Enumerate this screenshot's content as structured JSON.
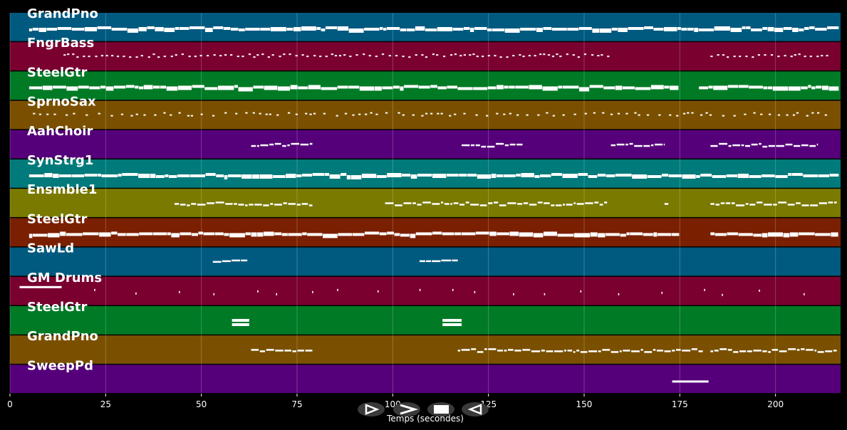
{
  "tracks": [
    {
      "name": "GrandPno",
      "color": "#005a80",
      "density": "continuous"
    },
    {
      "name": "FngrBass",
      "color": "#7a0030",
      "density": "dots"
    },
    {
      "name": "SteelGtr",
      "color": "#007a25",
      "density": "continuous"
    },
    {
      "name": "SprnoSax",
      "color": "#7a5000",
      "density": "dots"
    },
    {
      "name": "AahChoir",
      "color": "#55007a",
      "density": "phrases"
    },
    {
      "name": "SynStrg1",
      "color": "#007a7a",
      "density": "continuous"
    },
    {
      "name": "Ensmble1",
      "color": "#7a7a00",
      "density": "phrases"
    },
    {
      "name": "SteelGtr",
      "color": "#7a2000",
      "density": "continuous"
    },
    {
      "name": "SawLd",
      "color": "#005a80",
      "density": "sparse"
    },
    {
      "name": "GM Drums",
      "color": "#7a0030",
      "density": "hits"
    },
    {
      "name": "SteelGtr",
      "color": "#007a25",
      "density": "blocks"
    },
    {
      "name": "GrandPno",
      "color": "#7a5000",
      "density": "phrases"
    },
    {
      "name": "SweepPd",
      "color": "#55007a",
      "density": "single"
    }
  ],
  "x_axis": {
    "label": "Temps (secondes)",
    "range": [
      0,
      217
    ],
    "ticks": [
      "0",
      "25",
      "50",
      "75",
      "100",
      "125",
      "150",
      "175",
      "200"
    ]
  },
  "controls": [
    {
      "name": "play-icon"
    },
    {
      "name": "fast-forward-icon"
    },
    {
      "name": "stop-icon"
    },
    {
      "name": "rewind-icon"
    }
  ],
  "grid": true,
  "colors": {
    "background": "#000000",
    "note": "#ffffff",
    "grid": "#ffffff"
  }
}
